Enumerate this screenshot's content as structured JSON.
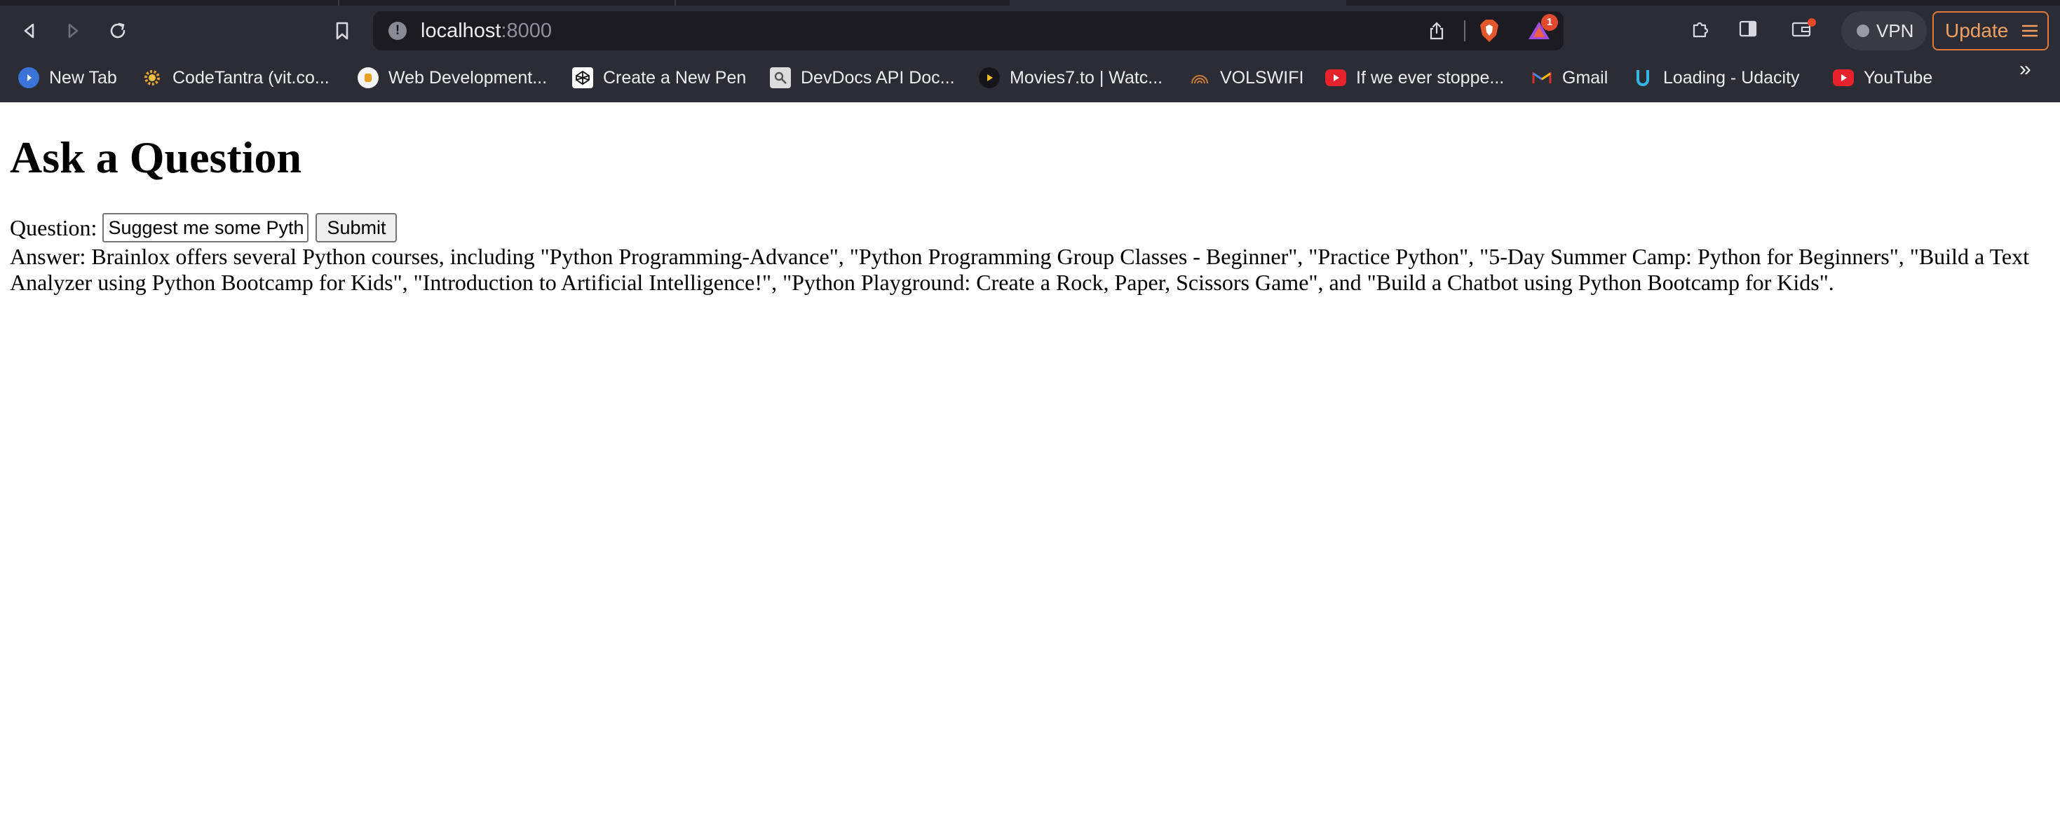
{
  "browser": {
    "url_host": "localhost",
    "url_port": ":8000",
    "rewards_badge": "1",
    "vpn_label": "VPN",
    "update_label": "Update",
    "bookmarks": [
      {
        "label": "New Tab",
        "icon": "brave-globe-icon"
      },
      {
        "label": "CodeTantra (vit.co...",
        "icon": "gear-sun-icon"
      },
      {
        "label": "Web Development...",
        "icon": "web-dev-icon"
      },
      {
        "label": "Create a New Pen",
        "icon": "codepen-icon"
      },
      {
        "label": "DevDocs API Doc...",
        "icon": "devdocs-icon"
      },
      {
        "label": "Movies7.to | Watc...",
        "icon": "play-icon"
      },
      {
        "label": "VOLSWIFI",
        "icon": "wifi-icon"
      },
      {
        "label": "If we ever stoppe...",
        "icon": "youtube-icon"
      },
      {
        "label": "Gmail",
        "icon": "gmail-icon"
      },
      {
        "label": "Loading - Udacity",
        "icon": "udacity-icon"
      },
      {
        "label": "YouTube",
        "icon": "youtube-icon"
      }
    ],
    "more_label": "»"
  },
  "page": {
    "title": "Ask a Question",
    "question_label": "Question:",
    "question_value": "Suggest me some Python courses",
    "submit_label": "Submit",
    "answer": "Answer: Brainlox offers several Python courses, including \"Python Programming-Advance\", \"Python Programming Group Classes - Beginner\", \"Practice Python\", \"5-Day Summer Camp: Python for Beginners\", \"Build a Text Analyzer using Python Bootcamp for Kids\", \"Introduction to Artificial Intelligence!\", \"Python Playground: Create a Rock, Paper, Scissors Game\", and \"Build a Chatbot using Python Bootcamp for Kids\"."
  },
  "colors": {
    "chrome_bg": "#2c2c35",
    "address_bg": "#1b1b21",
    "update_accent": "#e0783c",
    "badge_red": "#e2492f"
  }
}
